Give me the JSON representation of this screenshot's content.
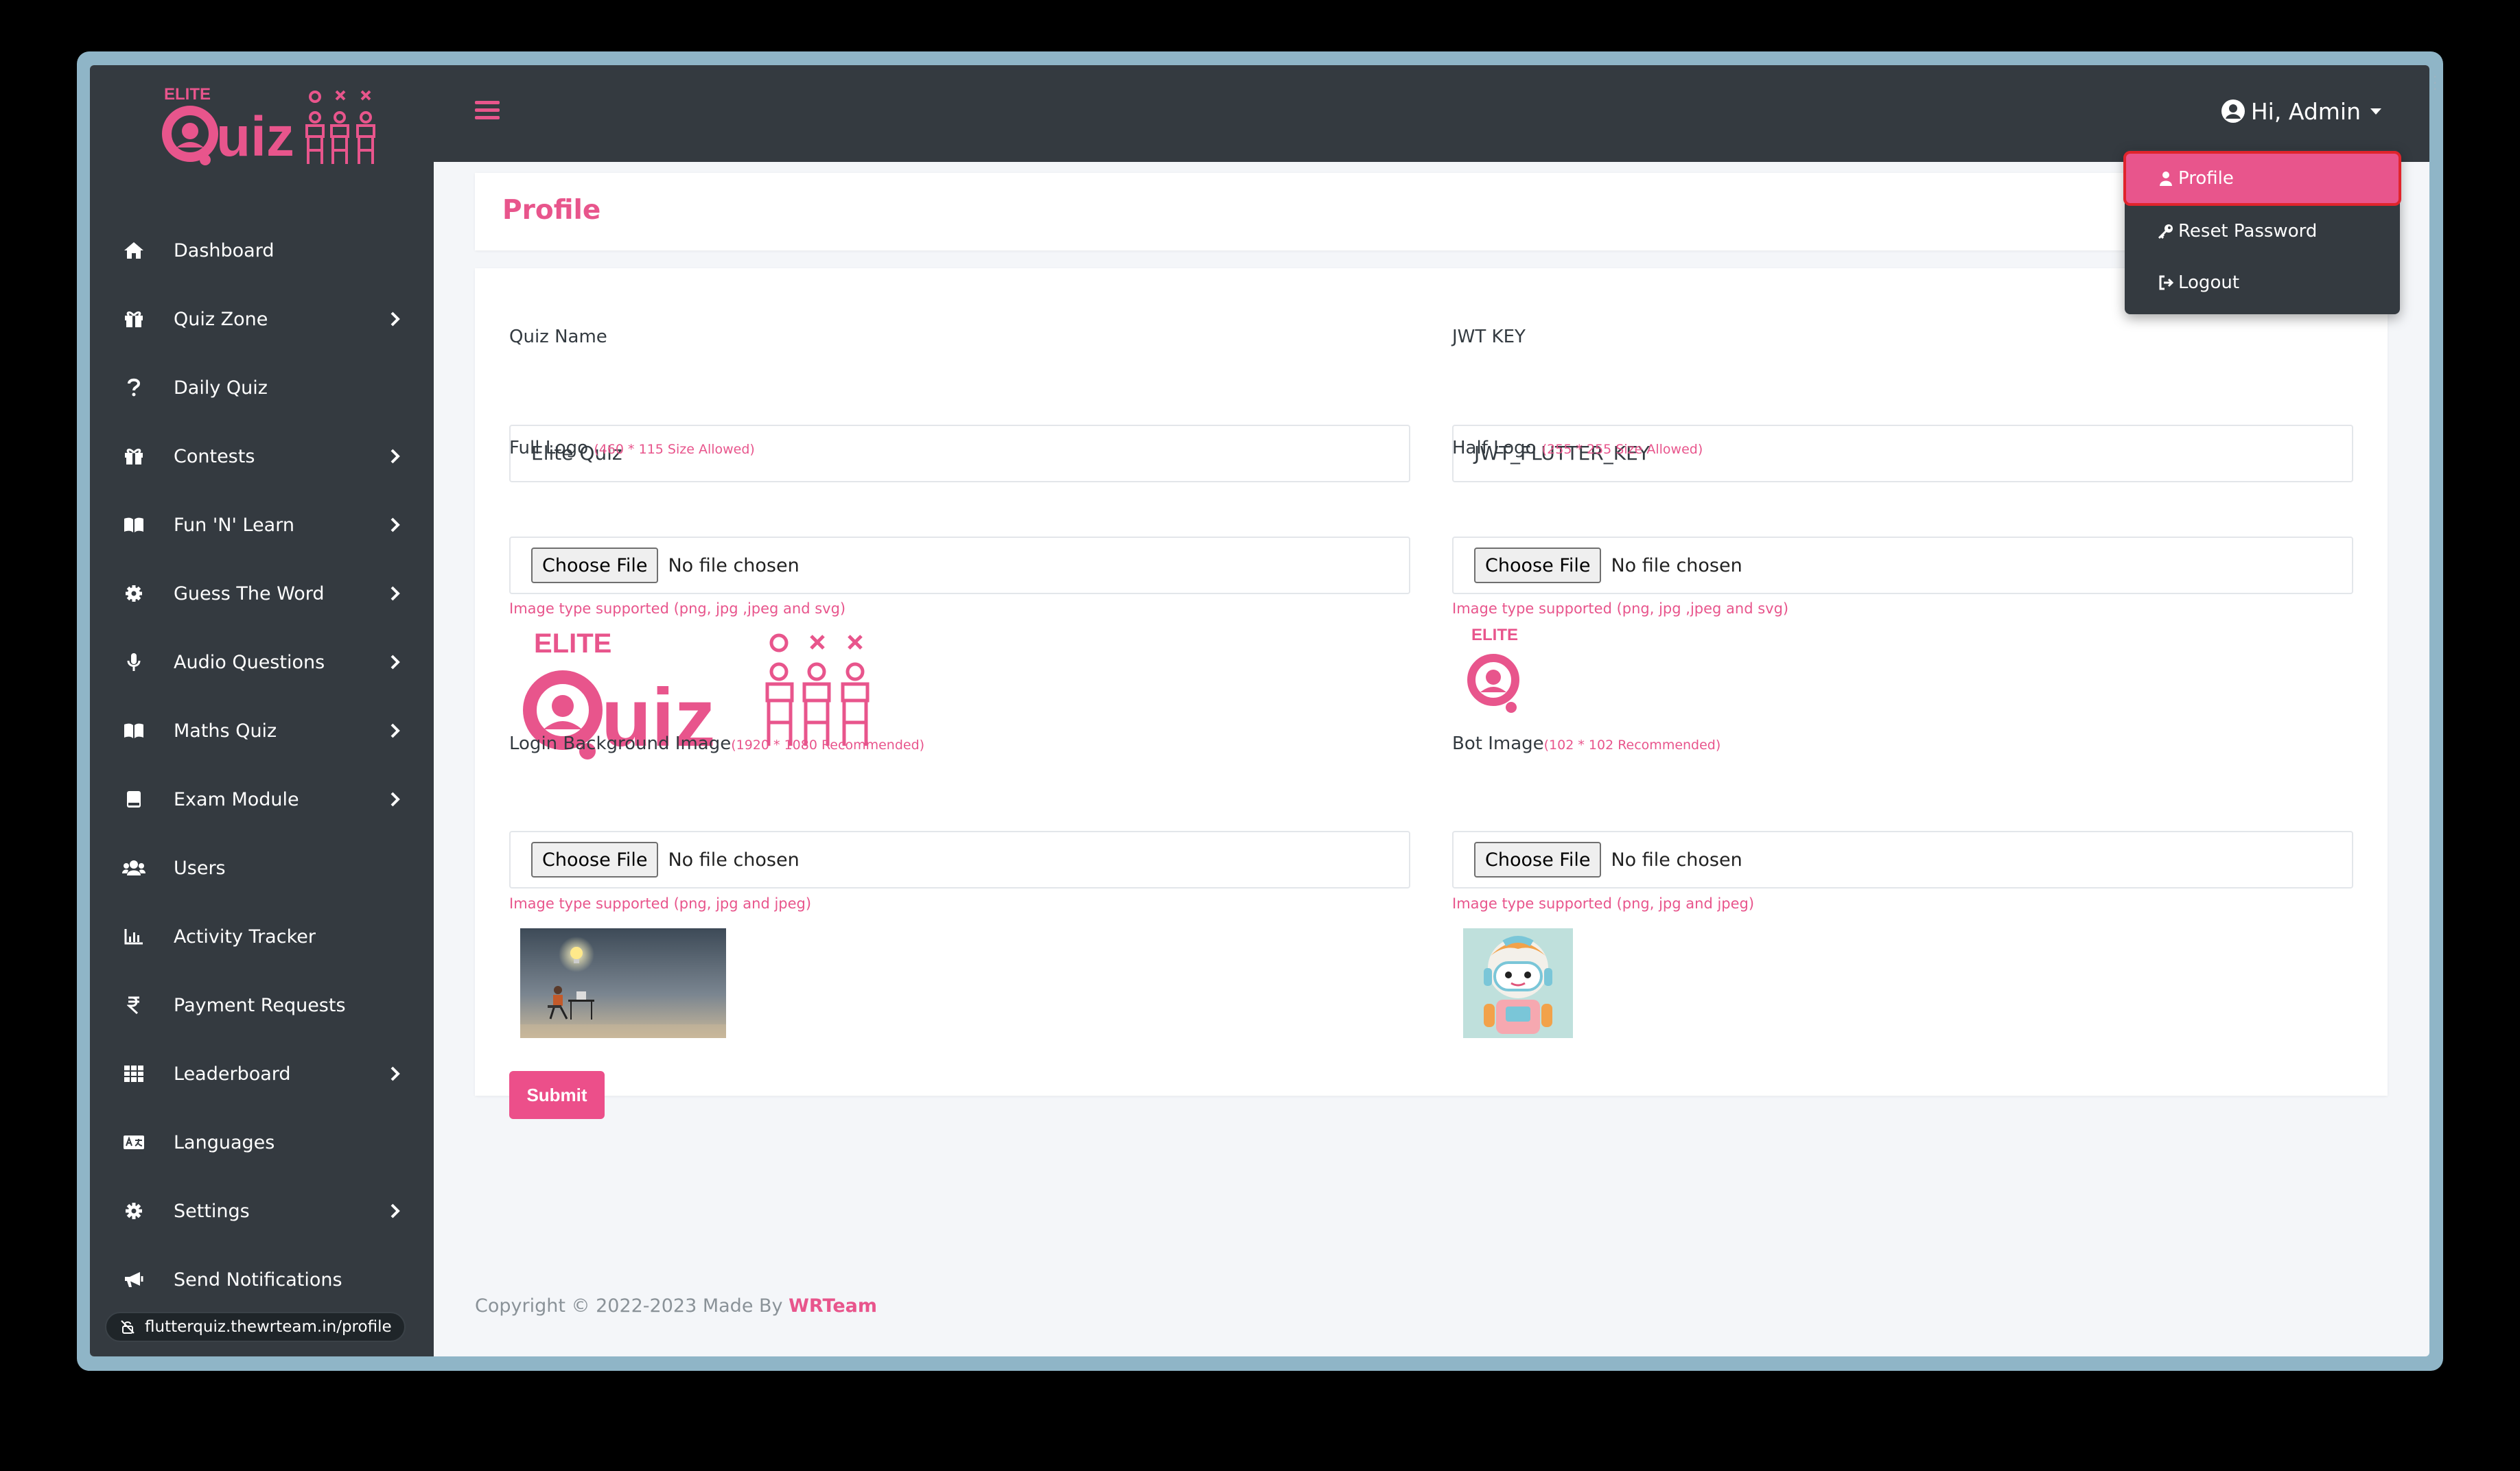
{
  "app": {
    "logo_text": "ELITE Quiz",
    "accent_color": "#e8558c"
  },
  "sidebar": {
    "items": [
      {
        "label": "Dashboard",
        "icon": "home-icon",
        "has_submenu": false
      },
      {
        "label": "Quiz Zone",
        "icon": "gift-icon",
        "has_submenu": true
      },
      {
        "label": "Daily Quiz",
        "icon": "question-icon",
        "has_submenu": false
      },
      {
        "label": "Contests",
        "icon": "gift-icon",
        "has_submenu": true
      },
      {
        "label": "Fun 'N' Learn",
        "icon": "book-icon",
        "has_submenu": true
      },
      {
        "label": "Guess The Word",
        "icon": "cog-icon",
        "has_submenu": true
      },
      {
        "label": "Audio Questions",
        "icon": "microphone-icon",
        "has_submenu": true
      },
      {
        "label": "Maths Quiz",
        "icon": "book-icon",
        "has_submenu": true
      },
      {
        "label": "Exam Module",
        "icon": "book-closed-icon",
        "has_submenu": true
      },
      {
        "label": "Users",
        "icon": "users-icon",
        "has_submenu": false
      },
      {
        "label": "Activity Tracker",
        "icon": "chart-icon",
        "has_submenu": false
      },
      {
        "label": "Payment Requests",
        "icon": "rupee-icon",
        "has_submenu": false
      },
      {
        "label": "Leaderboard",
        "icon": "grid-icon",
        "has_submenu": true
      },
      {
        "label": "Languages",
        "icon": "language-icon",
        "has_submenu": false
      },
      {
        "label": "Settings",
        "icon": "gear-icon",
        "has_submenu": true
      },
      {
        "label": "Send Notifications",
        "icon": "megaphone-icon",
        "has_submenu": false
      }
    ]
  },
  "status_bar": {
    "url": "flutterquiz.thewrteam.in/profile"
  },
  "topbar": {
    "user_label": "Hi, Admin"
  },
  "dropdown": {
    "items": [
      {
        "label": "Profile",
        "icon": "user-icon",
        "active": true
      },
      {
        "label": "Reset Password",
        "icon": "key-icon",
        "active": false
      },
      {
        "label": "Logout",
        "icon": "logout-icon",
        "active": false
      }
    ]
  },
  "page": {
    "title": "Profile"
  },
  "form": {
    "quiz_name": {
      "label": "Quiz Name",
      "value": "Elite Quiz"
    },
    "jwt_key": {
      "label": "JWT KEY",
      "value": "JWT_FLUTTER_KEY"
    },
    "full_logo": {
      "label": "Full Logo",
      "hint": "(460 * 115 Size Allowed)",
      "button": "Choose File",
      "status": "No file chosen",
      "note": "Image type supported (png, jpg ,jpeg and svg)"
    },
    "half_logo": {
      "label": "Half Logo",
      "hint": "(255 * 255 Size Allowed)",
      "button": "Choose File",
      "status": "No file chosen",
      "note": "Image type supported (png, jpg ,jpeg and svg)"
    },
    "login_bg": {
      "label": "Login Background Image",
      "hint": "(1920 * 1080 Recommended)",
      "button": "Choose File",
      "status": "No file chosen",
      "note": "Image type supported (png, jpg and jpeg)"
    },
    "bot_image": {
      "label": "Bot Image",
      "hint": "(102 * 102 Recommended)",
      "button": "Choose File",
      "status": "No file chosen",
      "note": "Image type supported (png, jpg and jpeg)"
    },
    "submit_label": "Submit"
  },
  "footer": {
    "text": "Copyright © 2022-2023 Made By",
    "brand": "WRTeam"
  }
}
